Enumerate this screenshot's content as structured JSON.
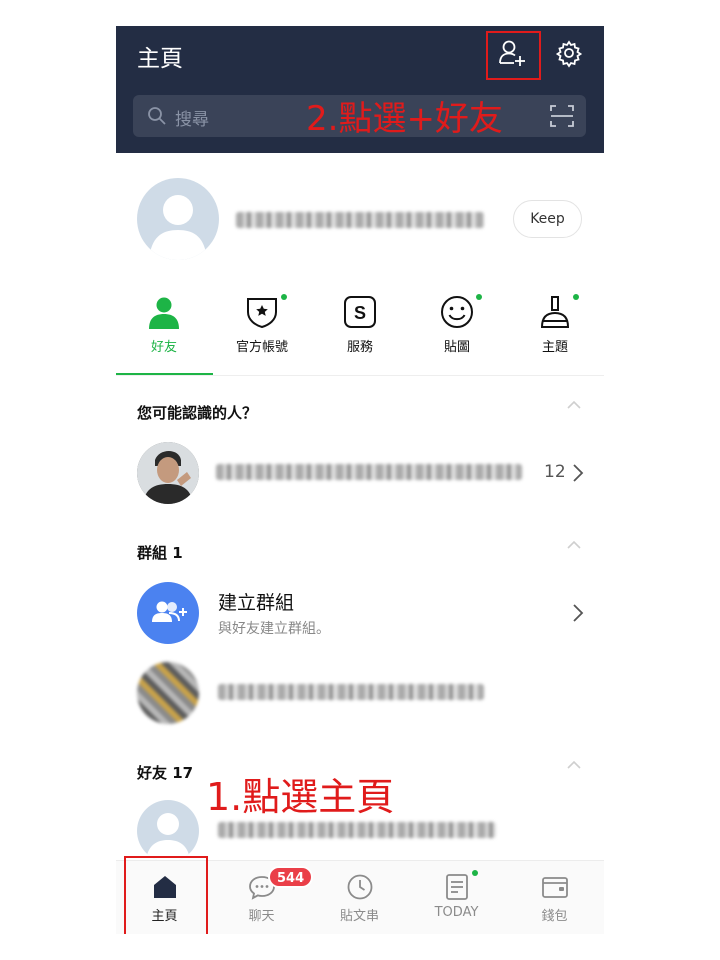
{
  "header": {
    "title": "主頁",
    "search_placeholder": "搜尋"
  },
  "profile": {
    "keep_label": "Keep"
  },
  "categories": [
    {
      "label": "好友",
      "icon": "person-icon",
      "active": true
    },
    {
      "label": "官方帳號",
      "icon": "shield-star-icon",
      "active": false
    },
    {
      "label": "服務",
      "icon": "service-s-icon",
      "active": false
    },
    {
      "label": "貼圖",
      "icon": "smiley-icon",
      "active": false
    },
    {
      "label": "主題",
      "icon": "brush-icon",
      "active": false
    }
  ],
  "suggested": {
    "title": "您可能認識的人？",
    "count": "12"
  },
  "groups": {
    "title": "群組 1",
    "create_title": "建立群組",
    "create_subtitle": "與好友建立群組。"
  },
  "friends": {
    "title": "好友 17"
  },
  "bottom_nav": [
    {
      "label": "主頁",
      "icon": "home-icon",
      "active": true
    },
    {
      "label": "聊天",
      "icon": "chat-icon",
      "active": false
    },
    {
      "label": "貼文串",
      "icon": "clock-icon",
      "active": false
    },
    {
      "label": "TODAY",
      "icon": "news-icon",
      "active": false
    },
    {
      "label": "錢包",
      "icon": "wallet-icon",
      "active": false
    }
  ],
  "chat_badge": "544",
  "annotations": {
    "step1": "1.點選主頁",
    "step2": "2.點選+好友"
  },
  "colors": {
    "header_bg": "#232d44",
    "accent_green": "#1db446",
    "badge_red": "#ea3f48",
    "annotation_red": "#e01b1b"
  }
}
